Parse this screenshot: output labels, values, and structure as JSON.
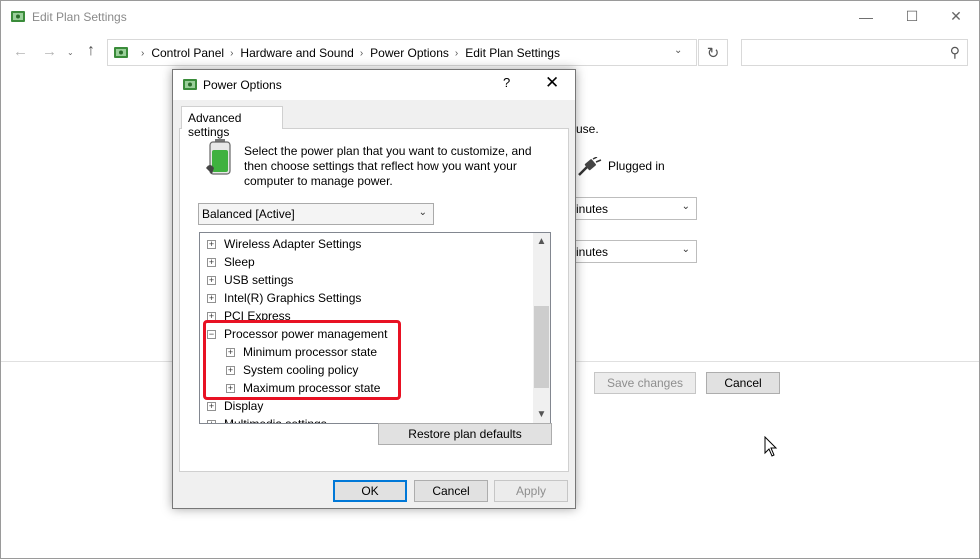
{
  "window": {
    "title": "Edit Plan Settings",
    "minimize": "—",
    "maximize": "☐",
    "close": "✕"
  },
  "nav": {
    "back": "←",
    "forward": "→",
    "recent": "⌄",
    "up": "↑",
    "breadcrumbs": [
      "Control Panel",
      "Hardware and Sound",
      "Power Options",
      "Edit Plan Settings"
    ],
    "separator": "›",
    "dropdown": "⌄",
    "refresh": "↻",
    "search_placeholder": "",
    "search_icon": "⚲"
  },
  "background": {
    "text_use": "use.",
    "plugged_in": "Plugged in",
    "select1": "inutes",
    "select2": "inutes",
    "chevron": "⌄",
    "save_changes": "Save changes",
    "cancel": "Cancel"
  },
  "dialog": {
    "title": "Power Options",
    "help": "?",
    "close": "✕",
    "tab": "Advanced settings",
    "intro": "Select the power plan that you want to customize, and then choose settings that reflect how you want your computer to manage power.",
    "plan": "Balanced [Active]",
    "chevron": "⌄",
    "tree": [
      {
        "label": "Wireless Adapter Settings",
        "level": 0,
        "expanded": false
      },
      {
        "label": "Sleep",
        "level": 0,
        "expanded": false
      },
      {
        "label": "USB settings",
        "level": 0,
        "expanded": false
      },
      {
        "label": "Intel(R) Graphics Settings",
        "level": 0,
        "expanded": false
      },
      {
        "label": "PCI Express",
        "level": 0,
        "expanded": false
      },
      {
        "label": "Processor power management",
        "level": 0,
        "expanded": true
      },
      {
        "label": "Minimum processor state",
        "level": 1,
        "expanded": false
      },
      {
        "label": "System cooling policy",
        "level": 1,
        "expanded": false
      },
      {
        "label": "Maximum processor state",
        "level": 1,
        "expanded": false
      },
      {
        "label": "Display",
        "level": 0,
        "expanded": false
      },
      {
        "label": "Multimedia settings",
        "level": 0,
        "expanded": false
      }
    ],
    "scroll_up": "▲",
    "scroll_down": "▼",
    "restore_defaults": "Restore plan defaults",
    "ok": "OK",
    "cancel": "Cancel",
    "apply": "Apply"
  },
  "colors": {
    "highlight": "#e81123",
    "focus": "#0078d7"
  }
}
